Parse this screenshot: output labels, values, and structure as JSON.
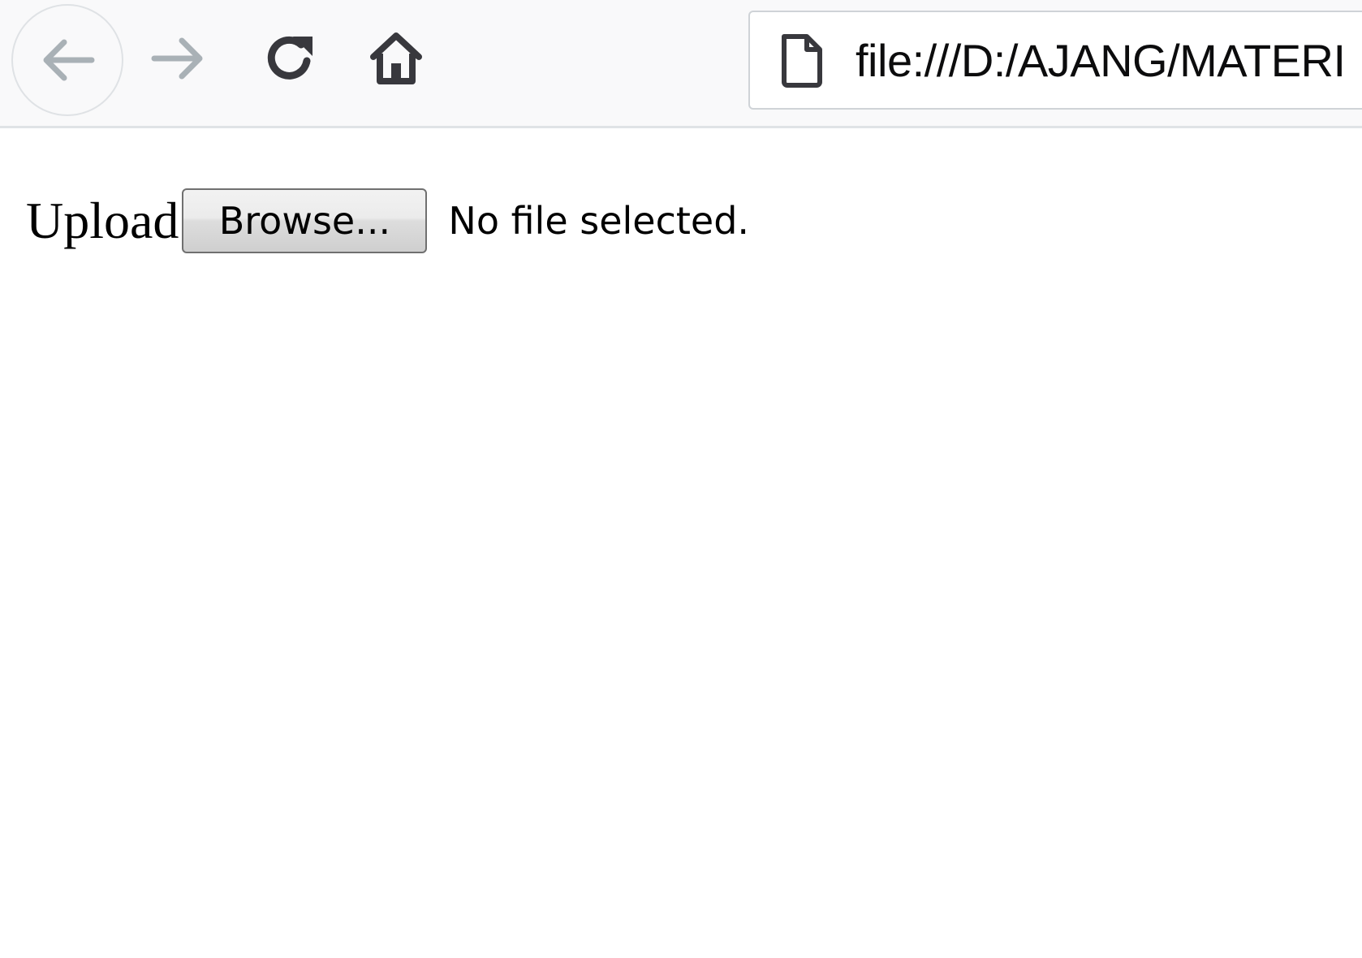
{
  "browser": {
    "url": "file:///D:/AJANG/MATERI",
    "icons": {
      "back": "back-arrow-icon",
      "forward": "forward-arrow-icon",
      "reload": "reload-icon",
      "home": "home-icon",
      "page": "page-icon"
    },
    "colors": {
      "toolbar_bg": "#f9f9fa",
      "icon_active": "#38383d",
      "icon_disabled": "#a9b1b6"
    }
  },
  "page": {
    "upload_label": "Upload",
    "browse_label": "Browse...",
    "file_status": "No file selected."
  }
}
